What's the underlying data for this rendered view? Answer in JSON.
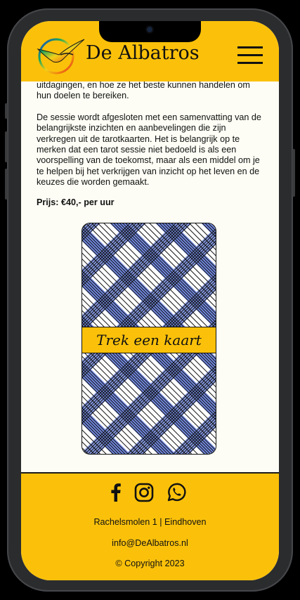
{
  "header": {
    "brand": "De Albatros",
    "logo_icon": "albatros-logo-icon",
    "menu_icon": "hamburger-menu-icon"
  },
  "content": {
    "paragraph_1": "uitdagingen, en hoe ze het beste kunnen handelen om hun doelen te bereiken.",
    "paragraph_2": "De sessie wordt afgesloten met een samenvatting van de belangrijkste inzichten en aanbevelingen die zijn verkregen uit de tarotkaarten. Het is belangrijk op te merken dat een tarot sessie niet bedoeld is als een voorspelling van de toekomst, maar als een middel om je te helpen bij het verkrijgen van inzicht op het leven en de keuzes die worden gemaakt.",
    "price": "Prijs: €40,- per uur"
  },
  "card": {
    "label": "Trek een kaart"
  },
  "footer": {
    "social_icons": [
      "facebook-icon",
      "instagram-icon",
      "whatsapp-icon"
    ],
    "address": "Rachelsmolen 1 | Eindhoven",
    "email": "info@DeAlbatros.nl",
    "copyright": "© Copyright 2023"
  },
  "colors": {
    "accent": "#fbc10a",
    "background": "#fdfdf5",
    "card_blue": "#7188e0"
  }
}
